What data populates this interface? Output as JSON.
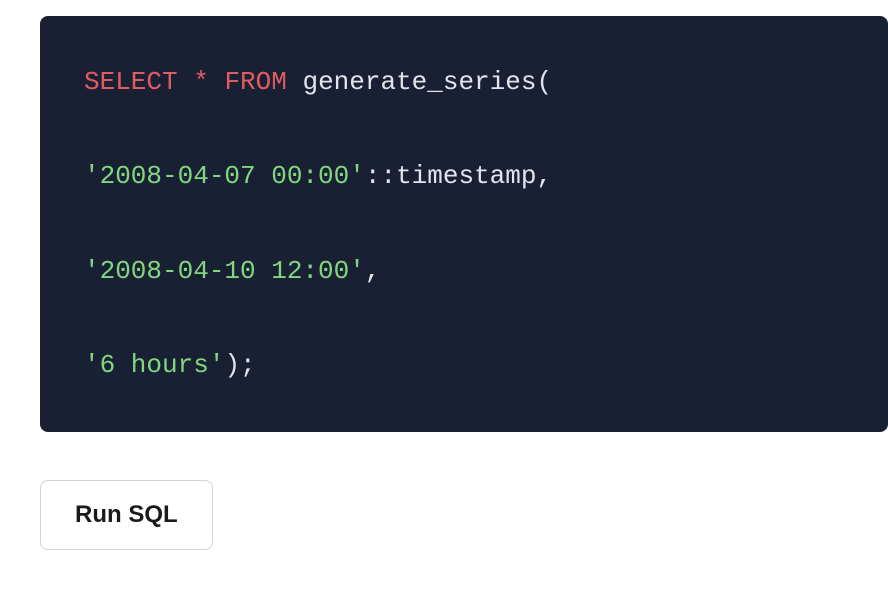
{
  "code": {
    "line1": {
      "select": "SELECT",
      "star": " * ",
      "from": "FROM",
      "func": " generate_series("
    },
    "line2": {
      "str": "'2008-04-07 00:00'",
      "cast": "::timestamp",
      "comma": ","
    },
    "line3": {
      "str": "'2008-04-10 12:00'",
      "comma": ","
    },
    "line4": {
      "str": "'6 hours'",
      "close": ");"
    }
  },
  "button": {
    "run_label": "Run SQL"
  }
}
